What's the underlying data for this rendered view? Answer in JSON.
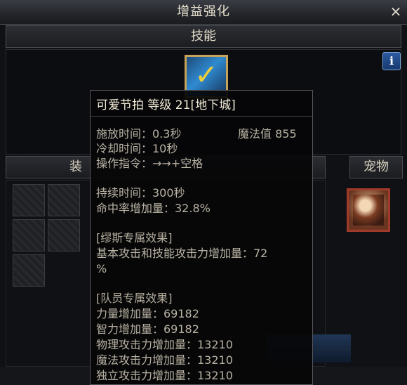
{
  "window": {
    "title": "增益强化",
    "close": "×"
  },
  "skill_tab": {
    "label": "技能"
  },
  "info_button": {
    "label": "i"
  },
  "equipment": {
    "header": "装",
    "pet_header": "宠物"
  },
  "tooltip": {
    "name": "可爱节拍 等级 21[地下城]",
    "cast_time": "施放时间：0.3秒",
    "mp": "魔法值 855",
    "cooldown": "冷却时间：10秒",
    "command": "操作指令：→→+空格",
    "duration": "持续时间：300秒",
    "hit_rate": "命中率增加量：32.8%",
    "muse_title": "[缪斯专属效果]",
    "muse_effect": "基本攻击和技能攻击力增加量：72",
    "muse_effect_cont": "%",
    "party_title": "[队员专属效果]",
    "str": "力量增加量：69182",
    "int": "智力增加量：69182",
    "phys": "物理攻击力增加量：13210",
    "mag": "魔法攻击力增加量：13210",
    "ind": "独立攻击力增加量：13210"
  }
}
